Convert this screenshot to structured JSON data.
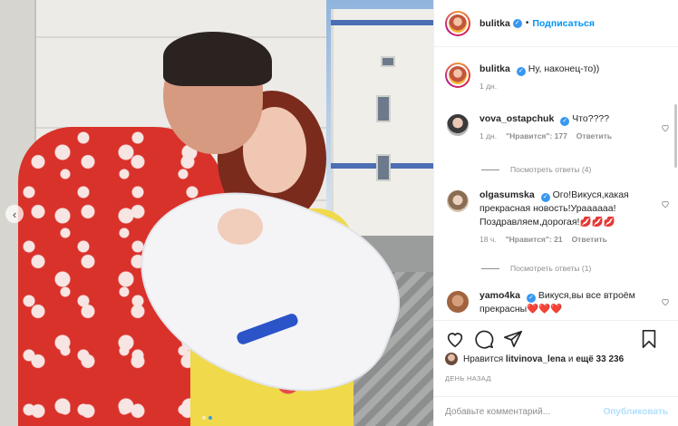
{
  "post": {
    "author": "bulitka",
    "follow_label": "Подписаться",
    "separator": "•",
    "carousel_dots": 2,
    "active_dot": 1
  },
  "comments": [
    {
      "username": "bulitka",
      "text": "Ну, наконец-то))",
      "time": "1 дн.",
      "likes": "",
      "reply": ""
    },
    {
      "username": "vova_ostapchuk",
      "text": "Что????",
      "time": "1 дн.",
      "likes": "\"Нравится\": 177",
      "reply": "Ответить",
      "view_replies": "Посмотреть ответы (4)"
    },
    {
      "username": "olgasumska",
      "text": "Ого!Викуся,какая прекрасная новость!Ураааааа! Поздравляем,дорогая!",
      "emoji": "💋💋💋",
      "time": "18 ч.",
      "likes": "\"Нравится\": 21",
      "reply": "Ответить",
      "view_replies": "Посмотреть ответы (1)"
    },
    {
      "username": "yamo4ka",
      "text": "Викуся,вы все втроём прекрасны",
      "emoji": "❤️❤️❤️"
    }
  ],
  "likes_line": {
    "prefix": "Нравится",
    "user": "litvinova_lena",
    "middle": "и",
    "count": "ещё 33 236"
  },
  "date_label": "ДЕНЬ НАЗАД",
  "add_comment": {
    "placeholder": "Добавьте комментарий...",
    "publish_label": "Опубликовать"
  },
  "colors": {
    "accent": "#0095f6",
    "verified": "#3897f0",
    "muted": "#8e8e8e",
    "publish_disabled": "#b2dffc"
  },
  "icons": [
    "chevron-left-icon",
    "heart-icon",
    "comment-icon",
    "share-icon",
    "bookmark-icon",
    "verified-icon"
  ]
}
